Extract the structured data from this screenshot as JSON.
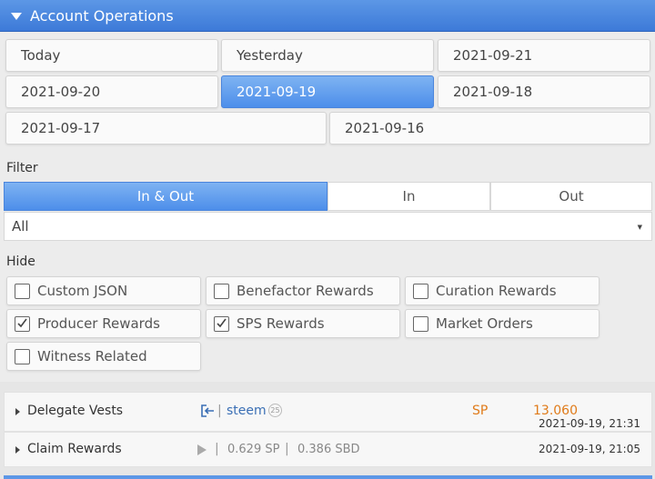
{
  "header": {
    "title": "Account Operations"
  },
  "dates": [
    "Today",
    "Yesterday",
    "2021-09-21",
    "2021-09-20",
    "2021-09-19",
    "2021-09-18",
    "2021-09-17",
    "2021-09-16"
  ],
  "dates_active": "2021-09-19",
  "filter": {
    "label": "Filter",
    "segments": [
      "In & Out",
      "In",
      "Out"
    ],
    "selected": "All"
  },
  "hide": {
    "label": "Hide",
    "options": [
      {
        "label": "Custom JSON",
        "checked": false
      },
      {
        "label": "Benefactor Rewards",
        "checked": false
      },
      {
        "label": "Curation Rewards",
        "checked": false
      },
      {
        "label": "Producer Rewards",
        "checked": true
      },
      {
        "label": "SPS Rewards",
        "checked": true
      },
      {
        "label": "Market Orders",
        "checked": false
      },
      {
        "label": "Witness Related",
        "checked": false
      }
    ]
  },
  "operations": [
    {
      "name": "Delegate Vests",
      "account": "steem",
      "reputation": "25",
      "currency": "SP",
      "amount": "13.060",
      "time": "2021-09-19, 21:31"
    },
    {
      "name": "Claim Rewards",
      "sp": "0.629 SP",
      "sbd": "0.386 SBD",
      "time": "2021-09-19, 21:05"
    }
  ],
  "colors": {
    "accent": "#4d8eea",
    "amount": "#e07b1a",
    "link": "#3a6fb5"
  }
}
